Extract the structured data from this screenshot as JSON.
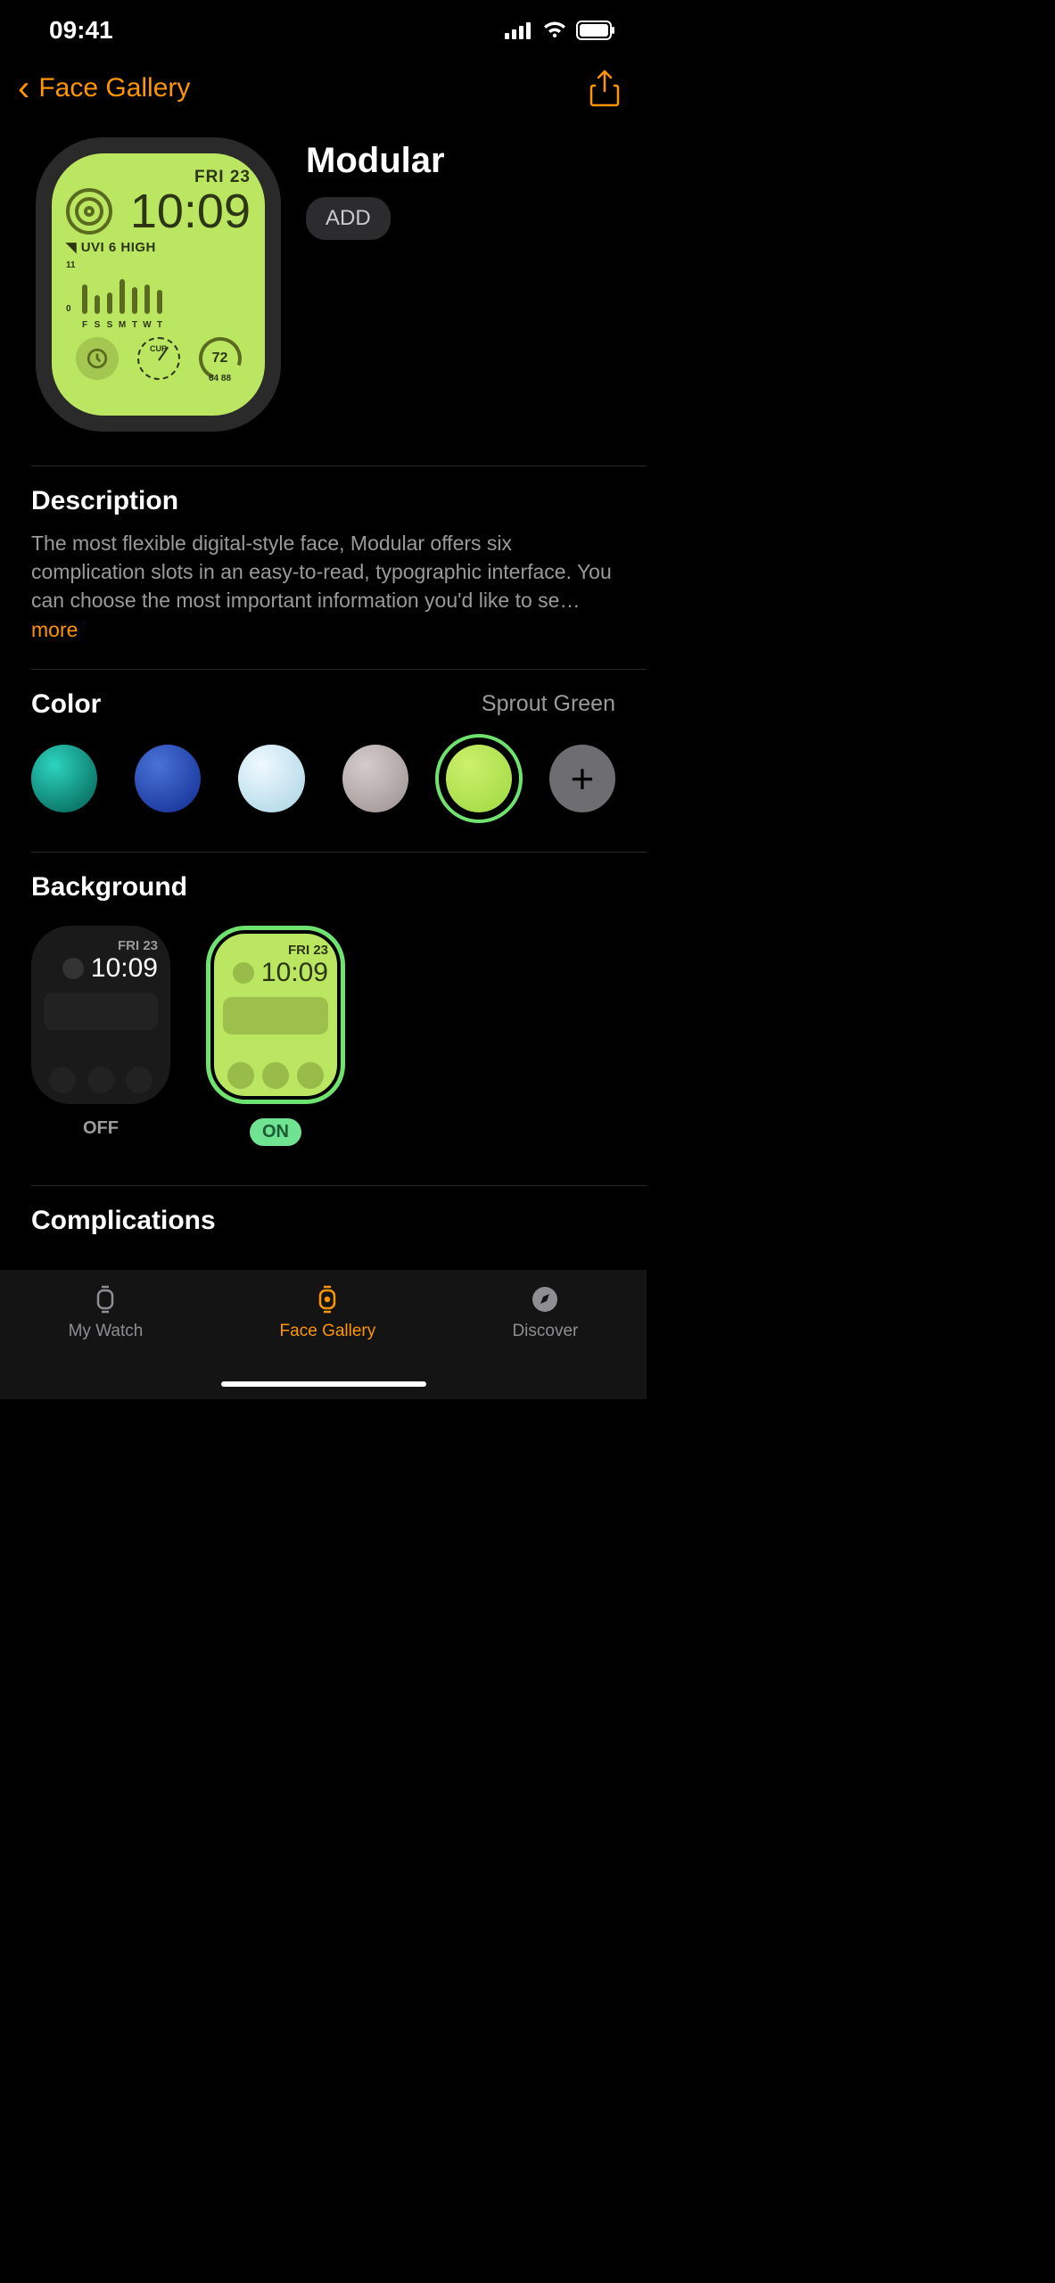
{
  "status": {
    "time": "09:41"
  },
  "nav": {
    "back_label": "Face Gallery"
  },
  "face": {
    "title": "Modular",
    "add_label": "ADD",
    "preview": {
      "date": "FRI 23",
      "time": "10:09",
      "uvi": "UVI 6 HIGH",
      "axis_hi": "11",
      "axis_lo": "0",
      "days": [
        "F",
        "S",
        "S",
        "M",
        "T",
        "W",
        "T"
      ],
      "cup": "CUP",
      "temp": "72",
      "range": "64  88"
    }
  },
  "description": {
    "heading": "Description",
    "text": "The most flexible digital-style face, Modular offers six complication slots in an easy-to-read, typographic interface. You can choose the most important information you'd like to se…",
    "more": "more"
  },
  "color": {
    "heading": "Color",
    "selected_name": "Sprout Green",
    "swatches": [
      {
        "gradient": "radial-gradient(circle at 35% 30%, #2dd4bf, #0c7a6b 75%)"
      },
      {
        "gradient": "radial-gradient(circle at 35% 30%, #4a72d6, #1b3aa0 80%)"
      },
      {
        "gradient": "radial-gradient(circle at 35% 30%, #eff9ff, #b7dbe9 80%)"
      },
      {
        "gradient": "radial-gradient(circle at 35% 30%, #d4cccc, #a79c9c 80%)"
      },
      {
        "gradient": "radial-gradient(circle at 35% 30%, #ccf06a, #a7dd4a 80%)",
        "selected": true
      }
    ]
  },
  "background": {
    "heading": "Background",
    "options": [
      {
        "label": "OFF",
        "date": "FRI 23",
        "time": "10:09"
      },
      {
        "label": "ON",
        "date": "FRI 23",
        "time": "10:09",
        "selected": true
      }
    ]
  },
  "complications": {
    "heading": "Complications"
  },
  "tabs": {
    "mywatch": "My Watch",
    "gallery": "Face Gallery",
    "discover": "Discover"
  }
}
